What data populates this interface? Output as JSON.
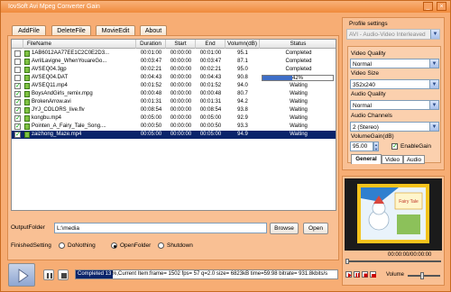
{
  "app": {
    "title": "IovSoft Avi Mpeg Converter Gain"
  },
  "toolbar": {
    "add_file": "AddFile",
    "delete_file": "DeleteFile",
    "movie_edit": "MovieEdit",
    "about": "About"
  },
  "grid": {
    "columns": [
      "FileName",
      "Duration",
      "Start",
      "End",
      "Volumn(dB)",
      "Status"
    ],
    "rows": [
      {
        "checked": false,
        "name": "1AB6012AA77EE1C2C0E2D3...",
        "duration": "00:01:00",
        "start": "00:00:00",
        "end": "00:01:00",
        "volume": "95.1",
        "status": "Completed",
        "selected": false
      },
      {
        "checked": false,
        "name": "AvrilLavigne_WhenYouareGo...",
        "duration": "00:03:47",
        "start": "00:00:00",
        "end": "00:03:47",
        "volume": "87.1",
        "status": "Completed",
        "selected": false
      },
      {
        "checked": false,
        "name": "AVSEQ04.3gp",
        "duration": "00:02:21",
        "start": "00:00:00",
        "end": "00:02:21",
        "volume": "95.0",
        "status": "Completed",
        "selected": false
      },
      {
        "checked": false,
        "name": "AVSEQ04.DAT",
        "duration": "00:04:43",
        "start": "00:00:00",
        "end": "00:04:43",
        "volume": "90.8",
        "status": "42%",
        "progress": 0.42,
        "selected": false
      },
      {
        "checked": true,
        "name": "AVSEQ11.mp4",
        "duration": "00:01:52",
        "start": "00:00:00",
        "end": "00:01:52",
        "volume": "94.0",
        "status": "Waiting",
        "selected": false
      },
      {
        "checked": true,
        "name": "BoysAndGirls_remix.mpg",
        "duration": "00:00:48",
        "start": "00:00:00",
        "end": "00:00:48",
        "volume": "80.7",
        "status": "Waiting",
        "selected": false
      },
      {
        "checked": true,
        "name": "BrokenArrow.avi",
        "duration": "00:01:31",
        "start": "00:00:00",
        "end": "00:01:31",
        "volume": "94.2",
        "status": "Waiting",
        "selected": false
      },
      {
        "checked": true,
        "name": "JYJ_COLORS_live.flv",
        "duration": "00:08:54",
        "start": "00:00:00",
        "end": "00:08:54",
        "volume": "93.8",
        "status": "Waiting",
        "selected": false
      },
      {
        "checked": true,
        "name": "kongbu.mp4",
        "duration": "00:05:00",
        "start": "00:00:00",
        "end": "00:05:00",
        "volume": "92.9",
        "status": "Waiting",
        "selected": false
      },
      {
        "checked": true,
        "name": "Pointen_A_Fairy_Tale_Song....",
        "duration": "00:00:50",
        "start": "00:00:00",
        "end": "00:00:50",
        "volume": "93.3",
        "status": "Waiting",
        "selected": false
      },
      {
        "checked": true,
        "name": "zaizhong_Maze.mp4",
        "duration": "00:05:00",
        "start": "00:00:00",
        "end": "00:05:00",
        "volume": "94.9",
        "status": "Waiting",
        "selected": true
      }
    ]
  },
  "output": {
    "label": "OutputFolder",
    "value": "L:\\media",
    "browse": "Browse",
    "open": "Open"
  },
  "finished": {
    "label": "FinishedSetting",
    "options": [
      "DoNothing",
      "OpenFolder",
      "Shutdown"
    ],
    "selected": "OpenFolder"
  },
  "status_bar": {
    "progress_label": "Completed 13",
    "info": "%,Current Item:frame= 1502 fps= 57 q=2.0 size=      6823kB time=59.98 bitrate= 931.8kbits/s"
  },
  "profile": {
    "label": "Profile settings",
    "value": "AVI - Audio-Video Interleaved",
    "video_quality_label": "Video Quality",
    "video_quality": "Normal",
    "video_size_label": "Video Size",
    "video_size": "352x240",
    "audio_quality_label": "Audio Quality",
    "audio_quality": "Normal",
    "audio_channels_label": "Audio Channels",
    "audio_channels": "2 (Stereo)",
    "volume_gain_label": "VolumeGain(dB)",
    "volume_gain": "95.00",
    "enable_gain_label": "EnableGain",
    "enable_gain": true,
    "tabs": [
      "General",
      "Video",
      "Audio"
    ],
    "active_tab": "General"
  },
  "preview": {
    "time": "00:00:00/00:00:00",
    "volume_label": "Volume",
    "screen_text": "Fairy Tale",
    "colors": {
      "screen_bg": "#1b1b1b",
      "frame": "#f4c31c"
    }
  }
}
